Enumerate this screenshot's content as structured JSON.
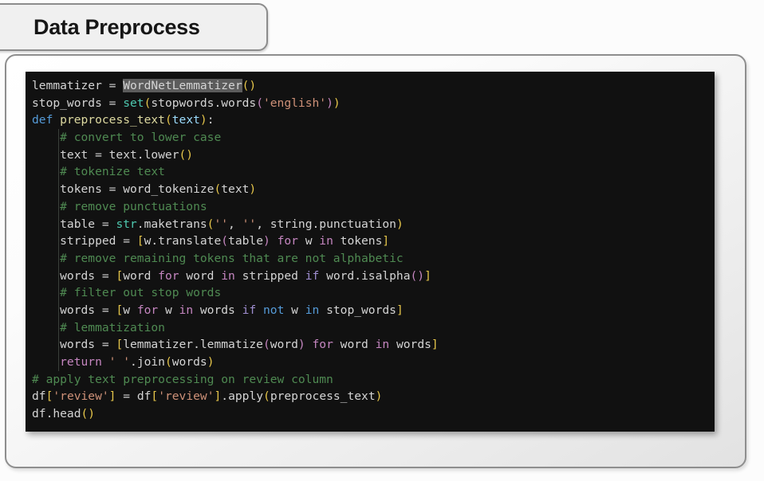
{
  "slide": {
    "title": "Data Preprocess",
    "background_color": "#fcfcfc",
    "card_border_color": "#8e8e8e"
  },
  "code_block": {
    "language": "python",
    "theme": "dark",
    "background_color": "#111111",
    "selection_text": "WordNetLemmatizer",
    "selection_color": "#5c5c5c",
    "full_text": "lemmatizer = WordNetLemmatizer()\nstop_words = set(stopwords.words('english'))\ndef preprocess_text(text):\n    # convert to lower case\n    text = text.lower()\n    # tokenize text\n    tokens = word_tokenize(text)\n    # remove punctuations\n    table = str.maketrans('', '', string.punctuation)\n    stripped = [w.translate(table) for w in tokens]\n    # remove remaining tokens that are not alphabetic\n    words = [word for word in stripped if word.isalpha()]\n    # filter out stop words\n    words = [w for w in words if not w in stop_words]\n    # lemmatization\n    words = [lemmatizer.lemmatize(word) for word in words]\n    return ' '.join(words)\n# apply text preprocessing on review column\ndf['review'] = df['review'].apply(preprocess_text)\ndf.head()",
    "lines": [
      "lemmatizer = WordNetLemmatizer()",
      "stop_words = set(stopwords.words('english'))",
      "def preprocess_text(text):",
      "    # convert to lower case",
      "    text = text.lower()",
      "    # tokenize text",
      "    tokens = word_tokenize(text)",
      "    # remove punctuations",
      "    table = str.maketrans('', '', string.punctuation)",
      "    stripped = [w.translate(table) for w in tokens]",
      "    # remove remaining tokens that are not alphabetic",
      "    words = [word for word in stripped if word.isalpha()]",
      "    # filter out stop words",
      "    words = [w for w in words if not w in stop_words]",
      "    # lemmatization",
      "    words = [lemmatizer.lemmatize(word) for word in words]",
      "    return ' '.join(words)",
      "# apply text preprocessing on review column",
      "df['review'] = df['review'].apply(preprocess_text)",
      "df.head()"
    ],
    "colors": {
      "comment": "#4f8a52",
      "keyword": "#559bd8",
      "keyword_flow": "#c586c0",
      "string": "#ce9178",
      "builtin_call": "#4ec9b0",
      "function_name": "#ddd9a0",
      "variable": "#9cdcfe",
      "bracket_1": "#e5c54a",
      "bracket_2": "#c586c0",
      "bracket_3": "#4fa9d8",
      "plain_text": "#d4d4d4"
    }
  }
}
